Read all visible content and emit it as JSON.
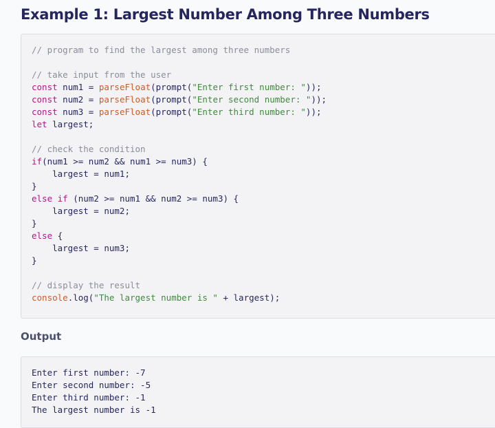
{
  "title": "Example 1: Largest Number Among Three Numbers",
  "output_heading": "Output",
  "colors": {
    "title": "#25265e",
    "comment": "#8a8d99",
    "keyword": "#b0178a",
    "function": "#ca5c23",
    "string": "#3f8a3b",
    "code_background": "#f3f3f5"
  },
  "code_lines": [
    [
      {
        "t": "// program to find the largest among three numbers",
        "k": "comment"
      }
    ],
    [],
    [
      {
        "t": "// take input from the user",
        "k": "comment"
      }
    ],
    [
      {
        "t": "const",
        "k": "keyword"
      },
      {
        "t": " num1 = ",
        "k": "plain"
      },
      {
        "t": "parseFloat",
        "k": "func"
      },
      {
        "t": "(prompt(",
        "k": "plain"
      },
      {
        "t": "\"Enter first number: \"",
        "k": "string"
      },
      {
        "t": "));",
        "k": "plain"
      }
    ],
    [
      {
        "t": "const",
        "k": "keyword"
      },
      {
        "t": " num2 = ",
        "k": "plain"
      },
      {
        "t": "parseFloat",
        "k": "func"
      },
      {
        "t": "(prompt(",
        "k": "plain"
      },
      {
        "t": "\"Enter second number: \"",
        "k": "string"
      },
      {
        "t": "));",
        "k": "plain"
      }
    ],
    [
      {
        "t": "const",
        "k": "keyword"
      },
      {
        "t": " num3 = ",
        "k": "plain"
      },
      {
        "t": "parseFloat",
        "k": "func"
      },
      {
        "t": "(prompt(",
        "k": "plain"
      },
      {
        "t": "\"Enter third number: \"",
        "k": "string"
      },
      {
        "t": "));",
        "k": "plain"
      }
    ],
    [
      {
        "t": "let",
        "k": "keyword"
      },
      {
        "t": " largest;",
        "k": "plain"
      }
    ],
    [],
    [
      {
        "t": "// check the condition",
        "k": "comment"
      }
    ],
    [
      {
        "t": "if",
        "k": "keyword"
      },
      {
        "t": "(num1 >= num2 && num1 >= num3) {",
        "k": "plain"
      }
    ],
    [
      {
        "t": "    largest = num1;",
        "k": "plain"
      }
    ],
    [
      {
        "t": "}",
        "k": "plain"
      }
    ],
    [
      {
        "t": "else",
        "k": "keyword"
      },
      {
        "t": " ",
        "k": "plain"
      },
      {
        "t": "if",
        "k": "keyword"
      },
      {
        "t": " (num2 >= num1 && num2 >= num3) {",
        "k": "plain"
      }
    ],
    [
      {
        "t": "    largest = num2;",
        "k": "plain"
      }
    ],
    [
      {
        "t": "}",
        "k": "plain"
      }
    ],
    [
      {
        "t": "else",
        "k": "keyword"
      },
      {
        "t": " {",
        "k": "plain"
      }
    ],
    [
      {
        "t": "    largest = num3;",
        "k": "plain"
      }
    ],
    [
      {
        "t": "}",
        "k": "plain"
      }
    ],
    [],
    [
      {
        "t": "// display the result",
        "k": "comment"
      }
    ],
    [
      {
        "t": "console",
        "k": "func"
      },
      {
        "t": ".log(",
        "k": "plain"
      },
      {
        "t": "\"The largest number is \"",
        "k": "string"
      },
      {
        "t": " + largest);",
        "k": "plain"
      }
    ]
  ],
  "output_lines": [
    "Enter first number: -7",
    "Enter second number: -5",
    "Enter third number: -1",
    "The largest number is -1"
  ]
}
